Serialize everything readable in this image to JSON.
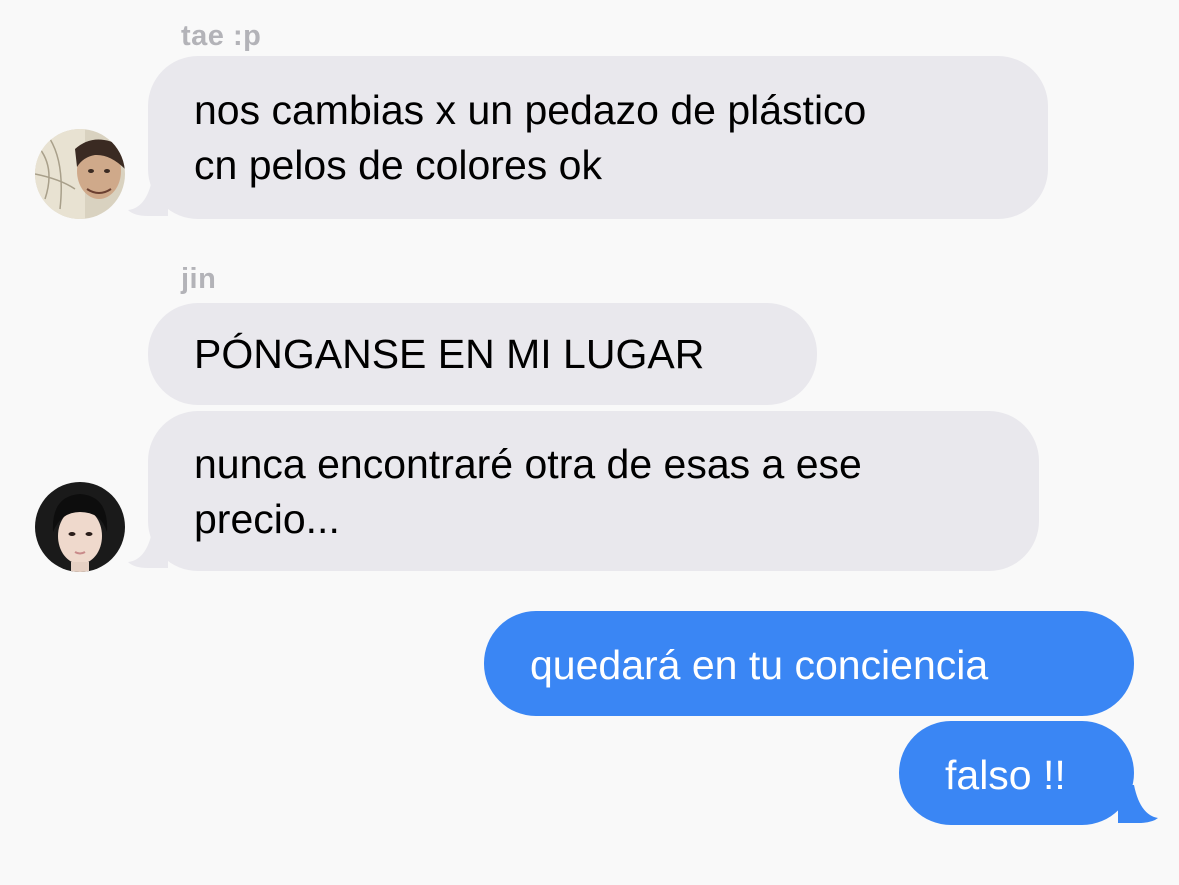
{
  "colors": {
    "background": "#f9f9f9",
    "incoming_bubble": "#e9e8ed",
    "outgoing_bubble": "#3a86f4",
    "sender_name": "#b3b3b8"
  },
  "messages": [
    {
      "id": "m1",
      "direction": "incoming",
      "sender": "tae :p",
      "lines": [
        "nos cambias x un pedazo de plástico",
        "cn pelos de colores ok"
      ]
    },
    {
      "id": "m2",
      "direction": "incoming",
      "sender": "jin",
      "lines": [
        "PÓNGANSE EN MI LUGAR"
      ]
    },
    {
      "id": "m3",
      "direction": "incoming",
      "sender": "jin",
      "lines": [
        "nunca encontraré otra de esas a ese",
        "precio..."
      ]
    },
    {
      "id": "m4",
      "direction": "outgoing",
      "lines": [
        "quedará en tu conciencia"
      ]
    },
    {
      "id": "m5",
      "direction": "outgoing",
      "lines": [
        "falso !!"
      ]
    }
  ],
  "avatars": [
    {
      "sender": "tae :p",
      "icon": "avatar-photo-icon"
    },
    {
      "sender": "jin",
      "icon": "avatar-photo-icon"
    }
  ]
}
